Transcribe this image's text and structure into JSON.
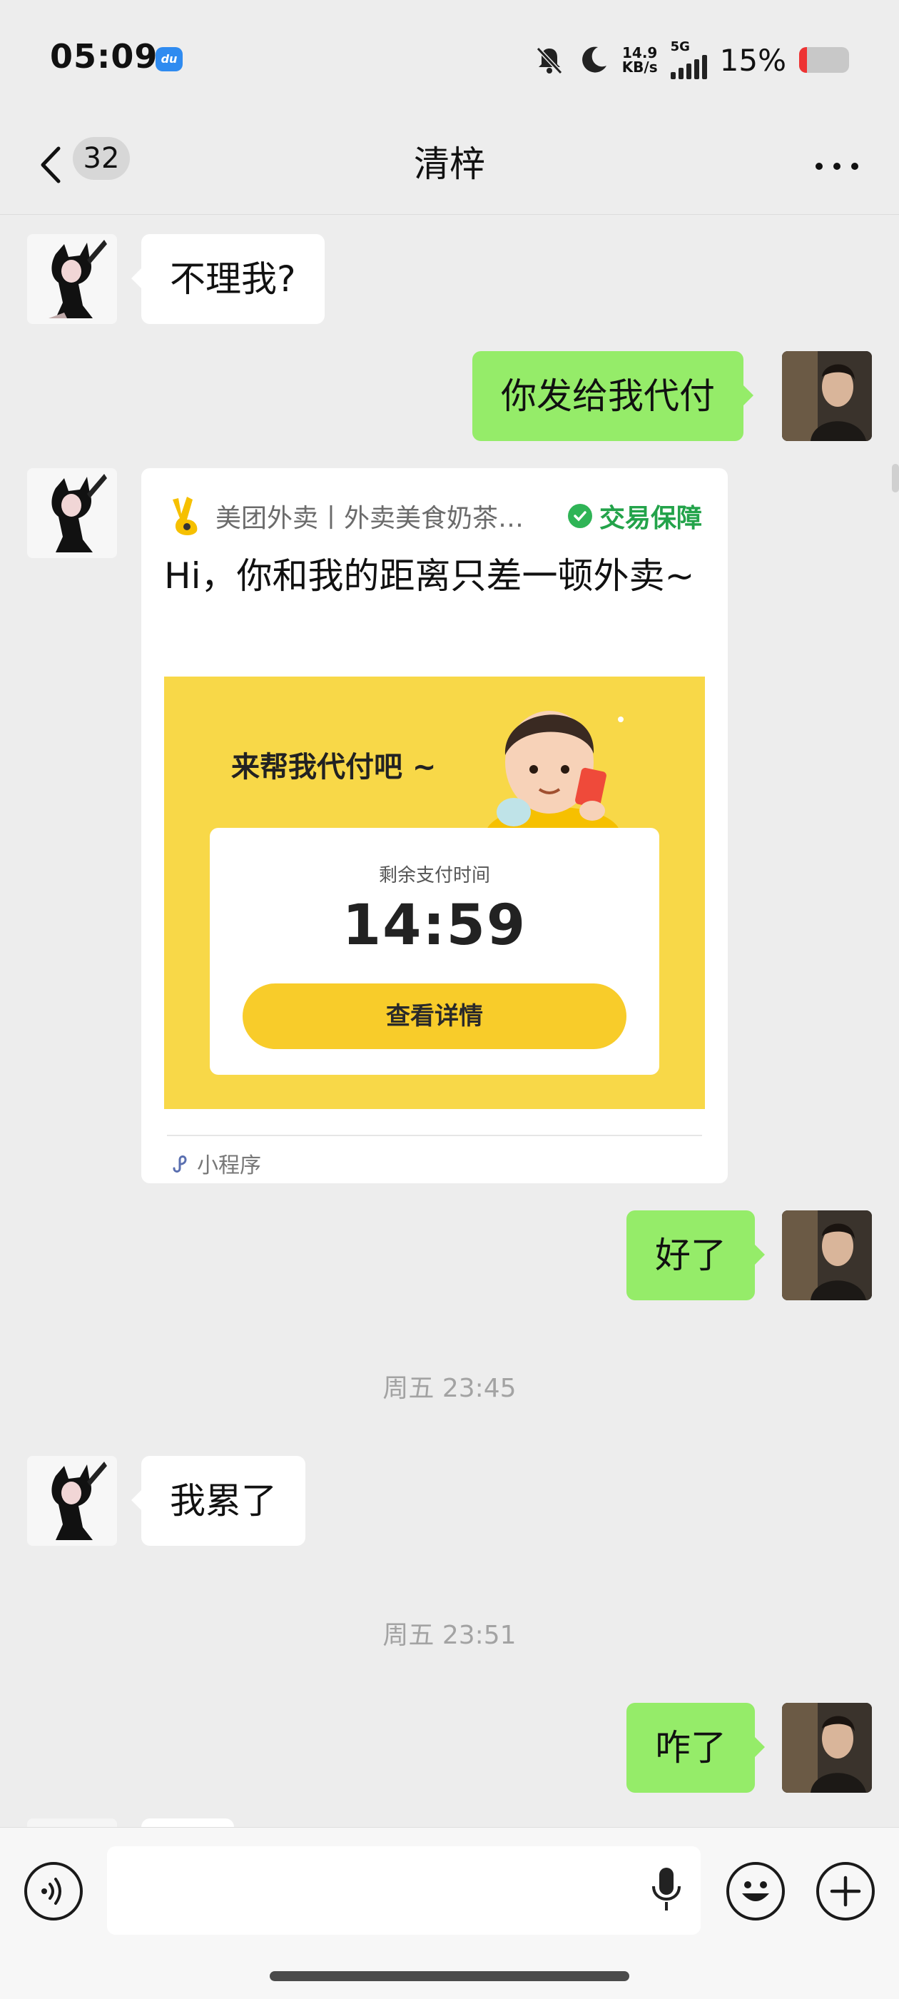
{
  "status_bar": {
    "time": "05:09",
    "app_badge": "du",
    "net_speed_value": "14.9",
    "net_speed_unit": "KB/s",
    "network": "5G",
    "battery_percent": "15%",
    "battery_level": 0.15
  },
  "nav": {
    "unread_count": "32",
    "chat_title": "清梓"
  },
  "messages": [
    {
      "side": "left",
      "text": "不理我?"
    },
    {
      "side": "right",
      "text": "你发给我代付"
    },
    {
      "side": "left",
      "type": "mini_program_card"
    },
    {
      "side": "right",
      "text": "好了"
    },
    {
      "type": "timestamp",
      "text": "周五 23:45"
    },
    {
      "side": "left",
      "text": "我累了"
    },
    {
      "type": "timestamp",
      "text": "周五 23:51"
    },
    {
      "side": "right",
      "text": "咋了"
    }
  ],
  "card": {
    "source": "美团外卖丨外卖美食奶茶…",
    "guarantee": "交易保障",
    "text": "Hi，你和我的距离只差一顿外卖~",
    "banner_title": "来帮我代付吧 ~",
    "countdown_label": "剩余支付时间",
    "countdown": "14:59",
    "button": "查看详情",
    "footer": "小程序"
  },
  "colors": {
    "background": "#ededed",
    "my_bubble": "#95ec69",
    "their_bubble": "#ffffff",
    "meituan_yellow": "#f8d848",
    "guarantee_green": "#23a34a"
  },
  "icons": [
    "back-arrow-icon",
    "more-dots-icon",
    "voice-mode-icon",
    "mic-icon",
    "emoji-icon",
    "plus-icon",
    "shield-check-icon",
    "mini-program-link-icon"
  ]
}
